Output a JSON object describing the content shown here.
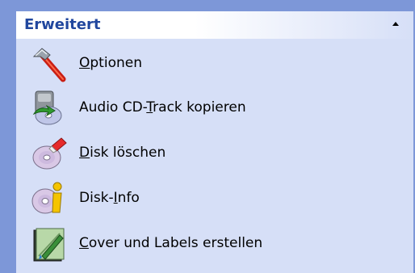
{
  "panel": {
    "title": "Erweitert",
    "collapse_icon": "chevron-up-icon",
    "items": [
      {
        "label_pre": "",
        "label_key": "O",
        "label_post": "ptionen",
        "icon": "hammer-icon"
      },
      {
        "label_pre": "Audio CD-",
        "label_key": "T",
        "label_post": "rack kopieren",
        "icon": "audio-cd-copy-icon"
      },
      {
        "label_pre": "",
        "label_key": "D",
        "label_post": "isk löschen",
        "icon": "erase-disc-icon"
      },
      {
        "label_pre": "Disk-",
        "label_key": "I",
        "label_post": "nfo",
        "icon": "disc-info-icon"
      },
      {
        "label_pre": "",
        "label_key": "C",
        "label_post": "over und Labels erstellen",
        "icon": "cover-label-icon"
      }
    ]
  },
  "colors": {
    "title": "#21479e",
    "panel_bg": "#d6dff7",
    "border": "#7d97d8"
  }
}
